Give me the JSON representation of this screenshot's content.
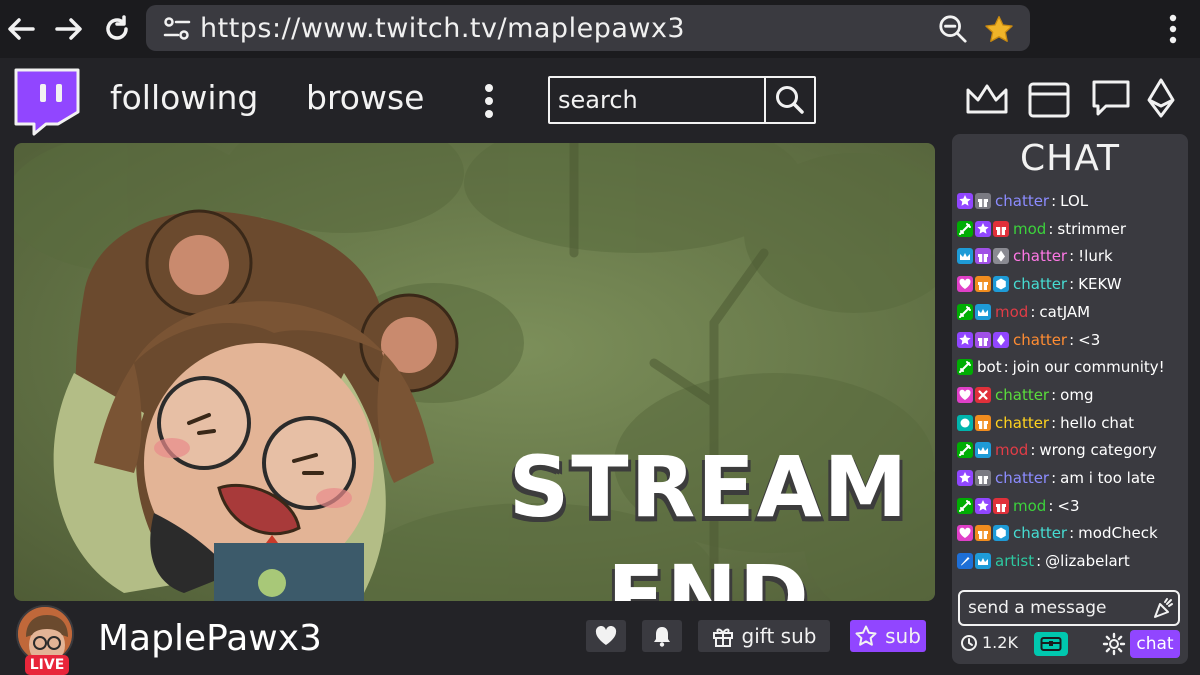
{
  "browser": {
    "url": "https://www.twitch.tv/maplepawx3"
  },
  "nav": {
    "following": "following",
    "browse": "browse",
    "search_placeholder": "search"
  },
  "player": {
    "overlay_line1": "STREAM",
    "overlay_line2": "END"
  },
  "channel": {
    "name": "MaplePawx3",
    "live_badge": "LIVE",
    "gift_sub": "gift sub",
    "sub": "sub"
  },
  "chat": {
    "title": "CHAT",
    "messages": [
      {
        "badges": [
          "purple-star",
          "gift-gray"
        ],
        "user": "chatter",
        "user_color": "#8c8cff",
        "text": "LOL"
      },
      {
        "badges": [
          "green-sword",
          "purple-star",
          "gift-red"
        ],
        "user": "mod",
        "user_color": "#3cd23c",
        "text": "strimmer"
      },
      {
        "badges": [
          "blue-crown",
          "gift-purple",
          "bits-gray"
        ],
        "user": "chatter",
        "user_color": "#ff78e6",
        "text": "!lurk"
      },
      {
        "badges": [
          "pink-heart",
          "gift-orange",
          "blue-hex"
        ],
        "user": "chatter",
        "user_color": "#46dcd2",
        "text": "KEKW"
      },
      {
        "badges": [
          "green-sword",
          "blue-crown"
        ],
        "user": "mod",
        "user_color": "#e03c46",
        "text": "catJAM"
      },
      {
        "badges": [
          "purple-star",
          "gift-purple",
          "bits-purple"
        ],
        "user": "chatter",
        "user_color": "#ff8c32",
        "text": "<3"
      },
      {
        "badges": [
          "green-sword"
        ],
        "user": "bot",
        "user_color": "#ffffff",
        "text": "join our community!"
      },
      {
        "badges": [
          "pink-heart",
          "red-x"
        ],
        "user": "chatter",
        "user_color": "#5adc3c",
        "text": "omg"
      },
      {
        "badges": [
          "teal-circle",
          "gift-orange"
        ],
        "user": "chatter",
        "user_color": "#ffd21e",
        "text": "hello chat"
      },
      {
        "badges": [
          "green-sword",
          "blue-crown"
        ],
        "user": "mod",
        "user_color": "#e03c46",
        "text": "wrong category"
      },
      {
        "badges": [
          "purple-star",
          "gift-gray"
        ],
        "user": "chatter",
        "user_color": "#8c8cff",
        "text": "am i too late"
      },
      {
        "badges": [
          "green-sword",
          "purple-star",
          "gift-red"
        ],
        "user": "mod",
        "user_color": "#3cd23c",
        "text": "<3"
      },
      {
        "badges": [
          "pink-heart",
          "gift-orange",
          "blue-hex"
        ],
        "user": "chatter",
        "user_color": "#46dcd2",
        "text": "modCheck"
      },
      {
        "badges": [
          "blue-brush",
          "blue-crown"
        ],
        "user": "artist",
        "user_color": "#2dc8a0",
        "text": "@lizabelart"
      }
    ],
    "send_placeholder": "send a message",
    "viewer_count": "1.2K",
    "chat_button": "chat"
  },
  "colors": {
    "twitch_purple": "#9146ff",
    "live_red": "#e8263a",
    "points_teal": "#00c8af"
  }
}
